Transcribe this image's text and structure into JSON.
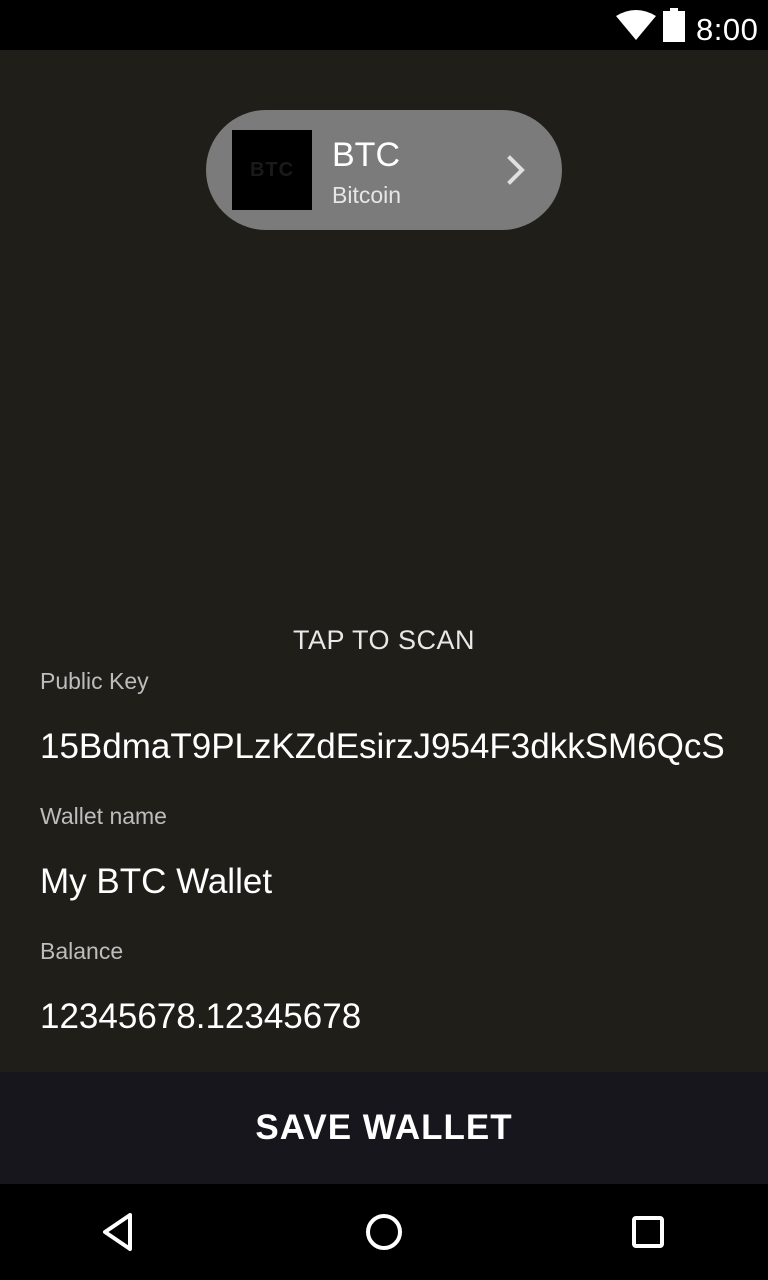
{
  "status_bar": {
    "time": "8:00",
    "wifi_icon": "wifi-icon",
    "battery_icon": "battery-icon"
  },
  "coin_selector": {
    "logo_text": "BTC",
    "symbol": "BTC",
    "name": "Bitcoin",
    "chevron_icon": "chevron-right-icon",
    "pill_color": "#7b7b7b"
  },
  "scan": {
    "label": "TAP TO SCAN"
  },
  "fields": {
    "public_key": {
      "label": "Public Key",
      "value": "15BdmaT9PLzKZdEsirzJ954F3dkkSM6QcS"
    },
    "wallet_name": {
      "label": "Wallet name",
      "value": "My BTC Wallet"
    },
    "balance": {
      "label": "Balance",
      "value": "12345678.12345678"
    }
  },
  "actions": {
    "save_label": "SAVE WALLET"
  },
  "nav_bar": {
    "back_icon": "back-triangle-icon",
    "home_icon": "home-circle-icon",
    "recents_icon": "recents-square-icon"
  },
  "colors": {
    "background": "#201e19",
    "button_background": "#17161d",
    "text_primary": "#ffffff",
    "text_secondary": "#bdbdbd"
  }
}
